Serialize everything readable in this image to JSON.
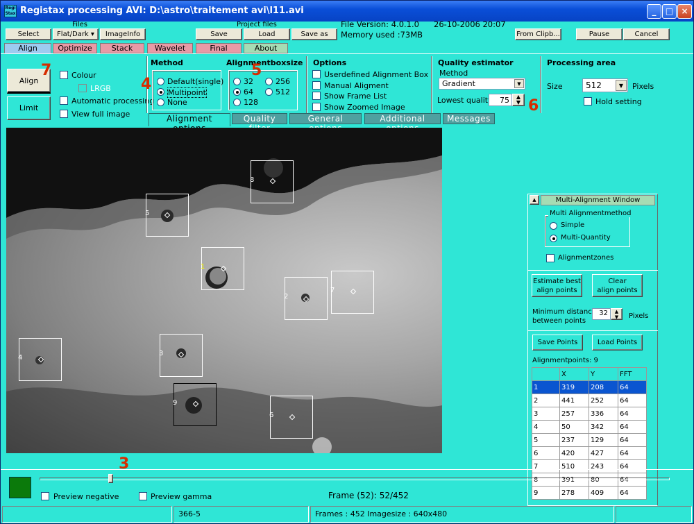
{
  "window": {
    "title": "Registax processing AVI: D:\\astro\\traitement avi\\l11.avi",
    "icon_text": "Regi Stax"
  },
  "menu": {
    "files_header": "Files",
    "project_header": "Project files",
    "select": "Select",
    "flatdark": "Flat/Dark ▾",
    "imageinfo": "ImageInfo",
    "save": "Save",
    "load": "Load",
    "saveas": "Save as",
    "file_version": "File Version: 4.0.1.0",
    "datetime": "26-10-2006 20:07",
    "memory": "Memory used :73MB",
    "from_clipb": "From Clipb...",
    "pause": "Pause",
    "cancel": "Cancel"
  },
  "tabs": [
    "Align",
    "Optimize",
    "Stack",
    "Wavelet",
    "Final",
    "About"
  ],
  "left": {
    "align": "Align",
    "limit": "Limit",
    "colour": "Colour",
    "lrgb": "LRGB",
    "auto": "Automatic processing",
    "fullimage": "View full image"
  },
  "method": {
    "title": "Method",
    "opts": [
      "Default(single)",
      "Multipoint",
      "None"
    ],
    "selected": "Multipoint"
  },
  "boxsize": {
    "title": "Alignmentboxsize",
    "opts": [
      "32",
      "256",
      "64",
      "512",
      "128"
    ],
    "selected": "64"
  },
  "options": {
    "title": "Options",
    "items": [
      "Userdefined Alignment Box",
      "Manual Aligment",
      "Show Frame List",
      "Show Zoomed Image"
    ]
  },
  "quality": {
    "title": "Quality estimator",
    "method_label": "Method",
    "method_value": "Gradient",
    "lowest_label": "Lowest quality",
    "lowest_value": "75"
  },
  "area": {
    "title": "Processing area",
    "size_label": "Size",
    "size_value": "512",
    "pixels": "Pixels",
    "hold": "Hold setting"
  },
  "subtabs": [
    "Alignment options",
    "Quality filter",
    "General options",
    "Additional options",
    "Messages"
  ],
  "annotations": {
    "a3": "3",
    "a4": "4",
    "a5": "5",
    "a6": "6",
    "a7": "7"
  },
  "boxes": [
    {
      "n": "1"
    },
    {
      "n": "2"
    },
    {
      "n": "3"
    },
    {
      "n": "4"
    },
    {
      "n": "5"
    },
    {
      "n": "6"
    },
    {
      "n": "7"
    },
    {
      "n": "8"
    },
    {
      "n": "9"
    }
  ],
  "multi": {
    "title": "Multi-Alignment Window",
    "collapse": "▲",
    "group": "Multi Alignmentmethod",
    "simple": "Simple",
    "multiq": "Multi-Quantity",
    "zones": "Alignmentzones",
    "estimate": "Estimate best\nalign points",
    "clear": "Clear\nalign points",
    "mindist": "Minimum distance\nbetween points",
    "mindist_value": "32",
    "pixels": "Pixels",
    "savepts": "Save Points",
    "loadpts": "Load Points",
    "count": "Alignmentpoints: 9",
    "headers": [
      "",
      "X",
      "Y",
      "FFT"
    ],
    "rows": [
      [
        "1",
        "319",
        "208",
        "64"
      ],
      [
        "2",
        "441",
        "252",
        "64"
      ],
      [
        "3",
        "257",
        "336",
        "64"
      ],
      [
        "4",
        "50",
        "342",
        "64"
      ],
      [
        "5",
        "237",
        "129",
        "64"
      ],
      [
        "6",
        "420",
        "427",
        "64"
      ],
      [
        "7",
        "510",
        "243",
        "64"
      ],
      [
        "8",
        "391",
        "80",
        "64"
      ],
      [
        "9",
        "278",
        "409",
        "64"
      ]
    ]
  },
  "bottom": {
    "preview_neg": "Preview negative",
    "preview_gamma": "Preview gamma",
    "frame": "Frame (52): 52/452"
  },
  "status": {
    "s1": "366-5",
    "s2": "Frames : 452 Imagesize : 640x480"
  }
}
